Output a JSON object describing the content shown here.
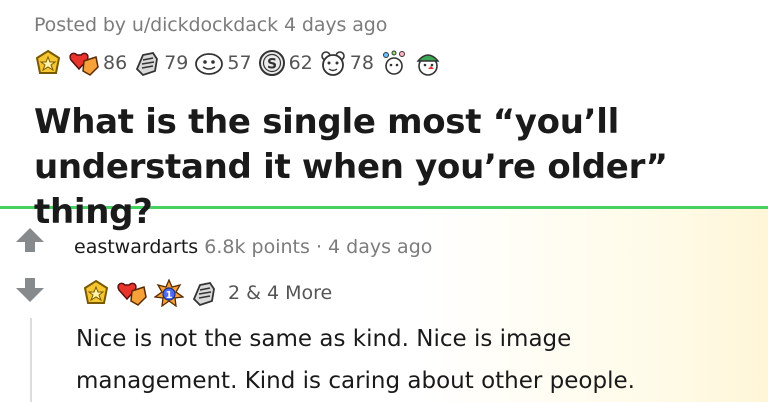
{
  "post": {
    "posted_by": "Posted by u/dickdockdack 4 days ago",
    "awards": [
      {
        "icon": "gold-badge-icon",
        "count": ""
      },
      {
        "icon": "heart-hands-icon",
        "count": "86"
      },
      {
        "icon": "helpful-hand-icon",
        "count": "79"
      },
      {
        "icon": "face-icon",
        "count": "57"
      },
      {
        "icon": "silver-coin-icon",
        "count": "62"
      },
      {
        "icon": "bear-icon",
        "count": "78"
      },
      {
        "icon": "party-icon",
        "count": ""
      },
      {
        "icon": "elf-hat-icon",
        "count": ""
      }
    ],
    "title_line1": "What is the single most “you’ll",
    "title_line2": "understand it when you’re older” thing?"
  },
  "comment": {
    "author": "eastwardarts",
    "points": "6.8k points",
    "separator": "·",
    "time": "4 days ago",
    "awards": [
      {
        "icon": "gold-badge-icon"
      },
      {
        "icon": "heart-hands-icon"
      },
      {
        "icon": "first-place-icon"
      },
      {
        "icon": "helpful-hand-icon"
      }
    ],
    "more_awards": "2 & 4 More",
    "body_line1": "Nice is not the same as kind. Nice is image",
    "body_line2": "management. Kind is caring about other people."
  },
  "colors": {
    "divider": "#46d160",
    "meta_gray": "#7c7c7c",
    "vote_arrow": "#878a8c"
  }
}
